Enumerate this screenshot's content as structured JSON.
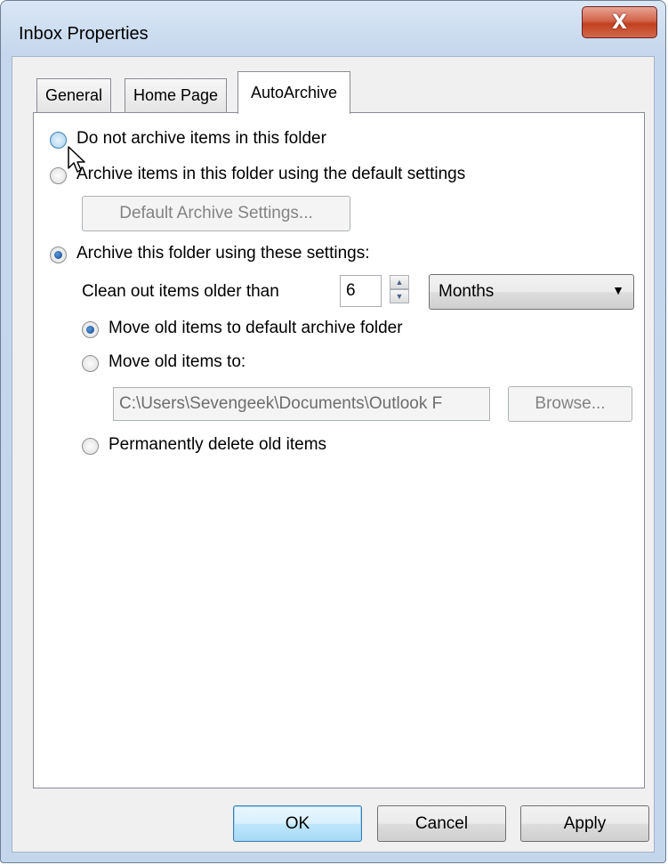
{
  "window": {
    "title": "Inbox Properties",
    "close_glyph": "X"
  },
  "tabs": [
    {
      "label": "General",
      "active": false
    },
    {
      "label": "Home Page",
      "active": false
    },
    {
      "label": "AutoArchive",
      "active": true
    }
  ],
  "autoarchive": {
    "opt_no_archive": "Do not archive items in this folder",
    "opt_default": "Archive items in this folder using the default settings",
    "default_settings_button": "Default Archive Settings...",
    "opt_custom": "Archive this folder using these settings:",
    "clean_out_label": "Clean out items older than",
    "age_value": "6",
    "age_unit": "Months",
    "move_default": "Move old items to default archive folder",
    "move_to": "Move old items to:",
    "path_value": "C:\\Users\\Sevengeek\\Documents\\Outlook F",
    "browse_button": "Browse...",
    "delete_old": "Permanently delete old items",
    "selected_main": "custom",
    "selected_action": "move_default"
  },
  "footer": {
    "ok": "OK",
    "cancel": "Cancel",
    "apply": "Apply"
  },
  "icons": [
    "close-icon",
    "radio-icon",
    "spin-up-icon",
    "spin-down-icon",
    "dropdown-arrow-icon",
    "mouse-pointer-icon"
  ]
}
